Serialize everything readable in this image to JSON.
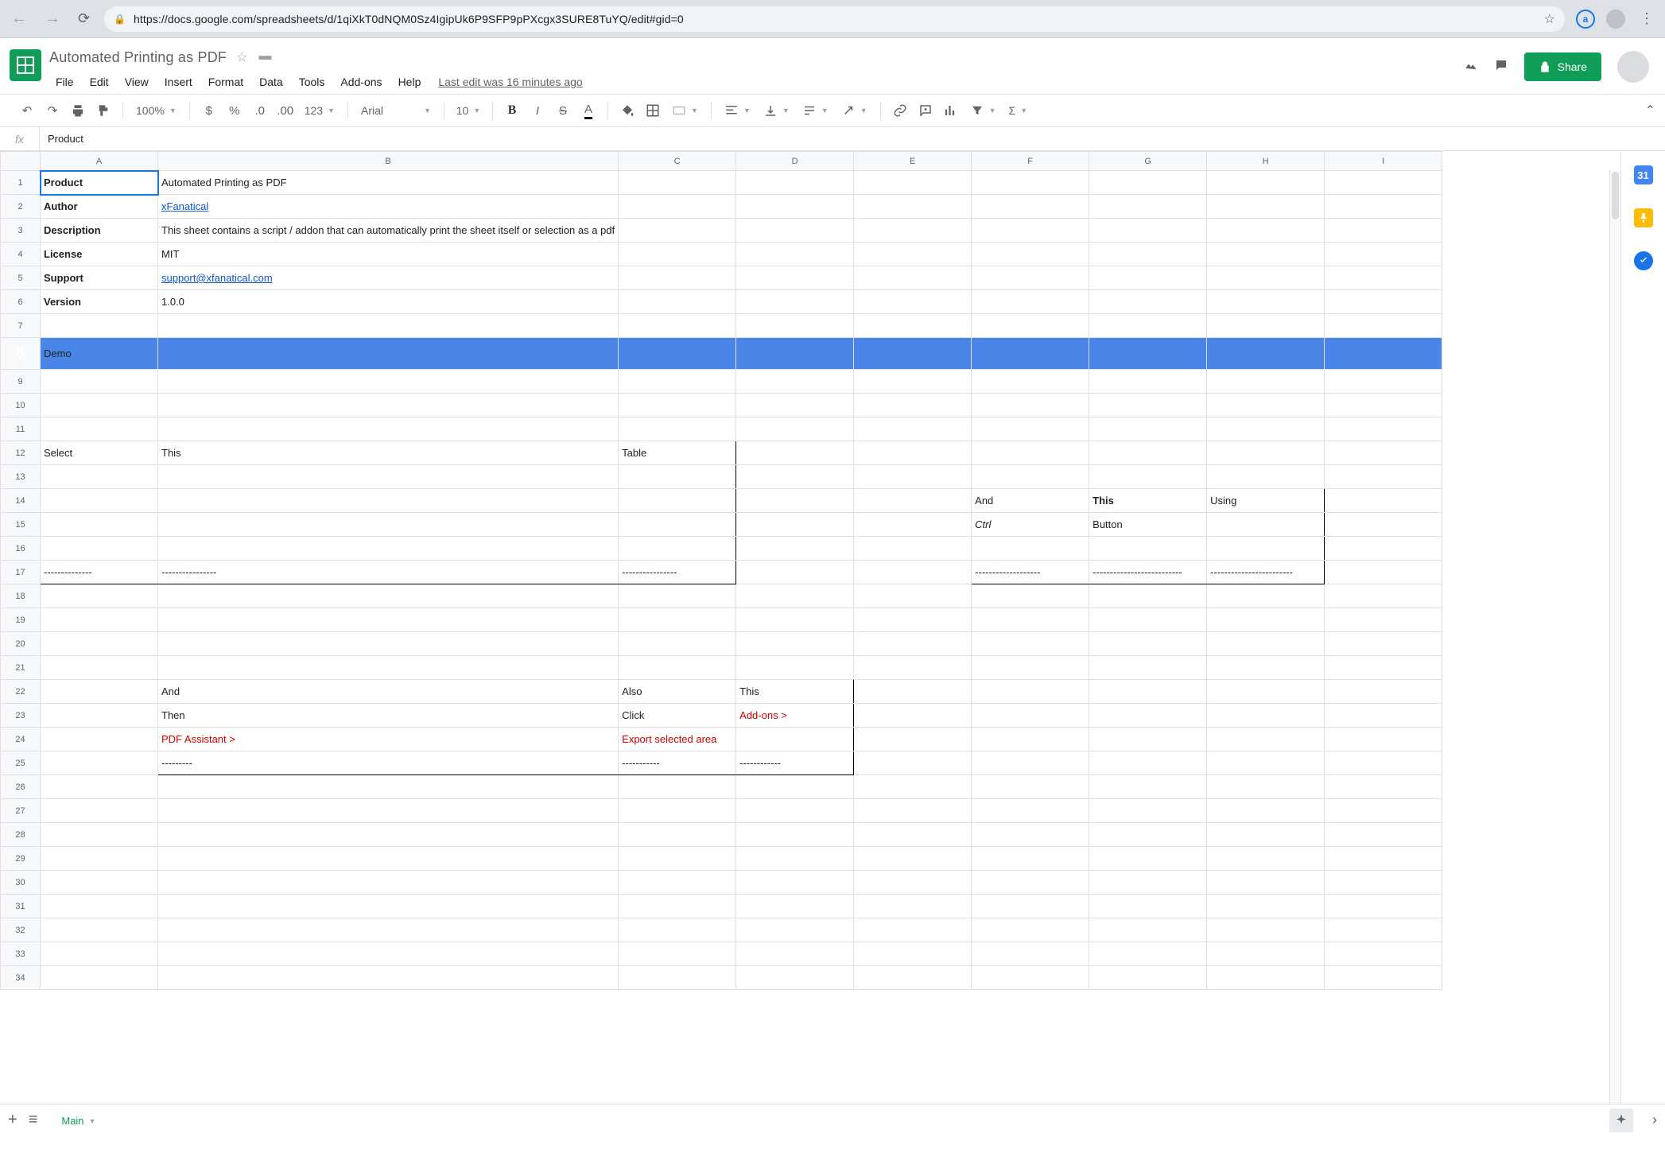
{
  "browser": {
    "url": "https://docs.google.com/spreadsheets/d/1qiXkT0dNQM0Sz4IgipUk6P9SFP9pPXcgx3SURE8TuYQ/edit#gid=0",
    "ext_badge": "a"
  },
  "doc": {
    "title": "Automated Printing as PDF",
    "last_edit": "Last edit was 16 minutes ago"
  },
  "menus": {
    "file": "File",
    "edit": "Edit",
    "view": "View",
    "insert": "Insert",
    "format": "Format",
    "data": "Data",
    "tools": "Tools",
    "addons": "Add-ons",
    "help": "Help"
  },
  "share": {
    "label": "Share"
  },
  "toolbar": {
    "zoom": "100%",
    "font": "Arial",
    "size": "10",
    "numfmt": "123"
  },
  "fx": {
    "label": "fx",
    "value": "Product"
  },
  "cols": {
    "A": "A",
    "B": "B",
    "C": "C",
    "D": "D",
    "E": "E",
    "F": "F",
    "G": "G",
    "H": "H",
    "I": "I"
  },
  "meta": {
    "product_l": "Product",
    "product_v": "Automated Printing as PDF",
    "author_l": "Author",
    "author_v": "xFanatical",
    "desc_l": "Description",
    "desc_v": "This sheet contains a script / addon that can automatically print the sheet itself or selection as a pdf",
    "license_l": "License",
    "license_v": "MIT",
    "support_l": "Support",
    "support_v": "support@xfanatical.com",
    "version_l": "Version",
    "version_v": "1.0.0"
  },
  "demo": {
    "heading": "Demo"
  },
  "box1": {
    "r1": {
      "a": "Select",
      "b": "This",
      "c": "Table"
    },
    "r6": {
      "a": "--------------",
      "b": "----------------",
      "c": "----------------"
    }
  },
  "box2": {
    "r1": {
      "f": "And",
      "g": "This",
      "h": "Using"
    },
    "r2": {
      "f": "Ctrl",
      "g": "Button"
    },
    "r4": {
      "f": "-------------------",
      "g": "--------------------------",
      "h": "------------------------"
    }
  },
  "box3": {
    "r1": {
      "b": "And",
      "c": "Also",
      "d": "This"
    },
    "r2": {
      "b": "Then",
      "c": "Click",
      "d": "Add-ons >"
    },
    "r3": {
      "b": "PDF Assistant >",
      "c": "Export selected area"
    },
    "r4": {
      "b": "---------",
      "c": "-----------",
      "d": "------------"
    }
  },
  "sheet": {
    "tab": "Main"
  },
  "side": {
    "cal": "31"
  }
}
